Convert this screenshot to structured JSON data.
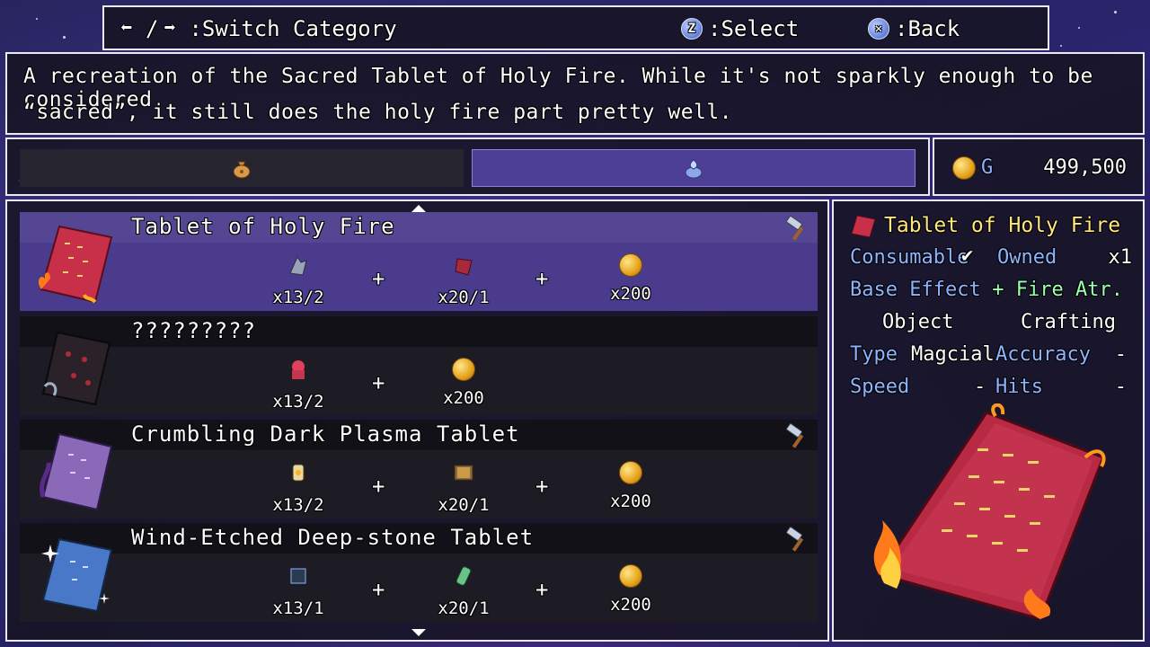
{
  "help": {
    "switch_label": ":Switch Category",
    "slash": "/",
    "select_key": "Z",
    "select_label": ":Select",
    "back_key": "✕",
    "back_label": ":Back"
  },
  "description": {
    "line1": "A recreation of the Sacred Tablet of Holy Fire. While it's not sparkly enough to be considered",
    "line2": "“sacred”, it still does the holy fire part pretty well."
  },
  "tabs": [
    {
      "icon": "item-bag-icon",
      "active": false
    },
    {
      "icon": "key-item-icon",
      "active": true
    }
  ],
  "gold": {
    "unit": "G",
    "amount": "499,500"
  },
  "recipes": [
    {
      "name": "Tablet of Holy Fire",
      "selected": true,
      "craftable": true,
      "ingredients": [
        {
          "icon": "grey-claw-icon",
          "qty": "x13/2"
        },
        {
          "icon": "red-shard-icon",
          "qty": "x20/1"
        },
        {
          "icon": "gold-coin-icon",
          "qty": "x200"
        }
      ]
    },
    {
      "name": "?????????",
      "selected": false,
      "craftable": false,
      "ingredients": [
        {
          "icon": "red-flower-icon",
          "qty": "x13/2"
        },
        {
          "icon": "gold-coin-icon",
          "qty": "x200"
        }
      ]
    },
    {
      "name": "Crumbling Dark Plasma Tablet",
      "selected": false,
      "craftable": true,
      "ingredients": [
        {
          "icon": "lantern-icon",
          "qty": "x13/2"
        },
        {
          "icon": "book-icon",
          "qty": "x20/1"
        },
        {
          "icon": "gold-coin-icon",
          "qty": "x200"
        }
      ]
    },
    {
      "name": "Wind-Etched Deep-stone Tablet",
      "selected": false,
      "craftable": true,
      "ingredients": [
        {
          "icon": "dark-cube-icon",
          "qty": "x13/1"
        },
        {
          "icon": "green-vial-icon",
          "qty": "x20/1"
        },
        {
          "icon": "gold-coin-icon",
          "qty": "x200"
        }
      ]
    }
  ],
  "plus": "+",
  "detail": {
    "title": "Tablet of Holy Fire",
    "consumable_label": "Consumable",
    "consumable_mark": "✔",
    "owned_label": "Owned",
    "owned_value": "x1",
    "base_effect_label": "Base Effect",
    "base_effect_value": "+ Fire Atr.",
    "object_label": "Object",
    "object_value": "Crafting",
    "type_label": "Type",
    "type_value": "Magcial",
    "accuracy_label": "Accuracy",
    "accuracy_value": "-",
    "speed_label": "Speed",
    "speed_value": "-",
    "hits_label": "Hits",
    "hits_value": "-"
  },
  "colors": {
    "accent_blue": "#8fb4ff",
    "selected_row": "#4a3b8c",
    "title_yellow": "#ffe680"
  }
}
